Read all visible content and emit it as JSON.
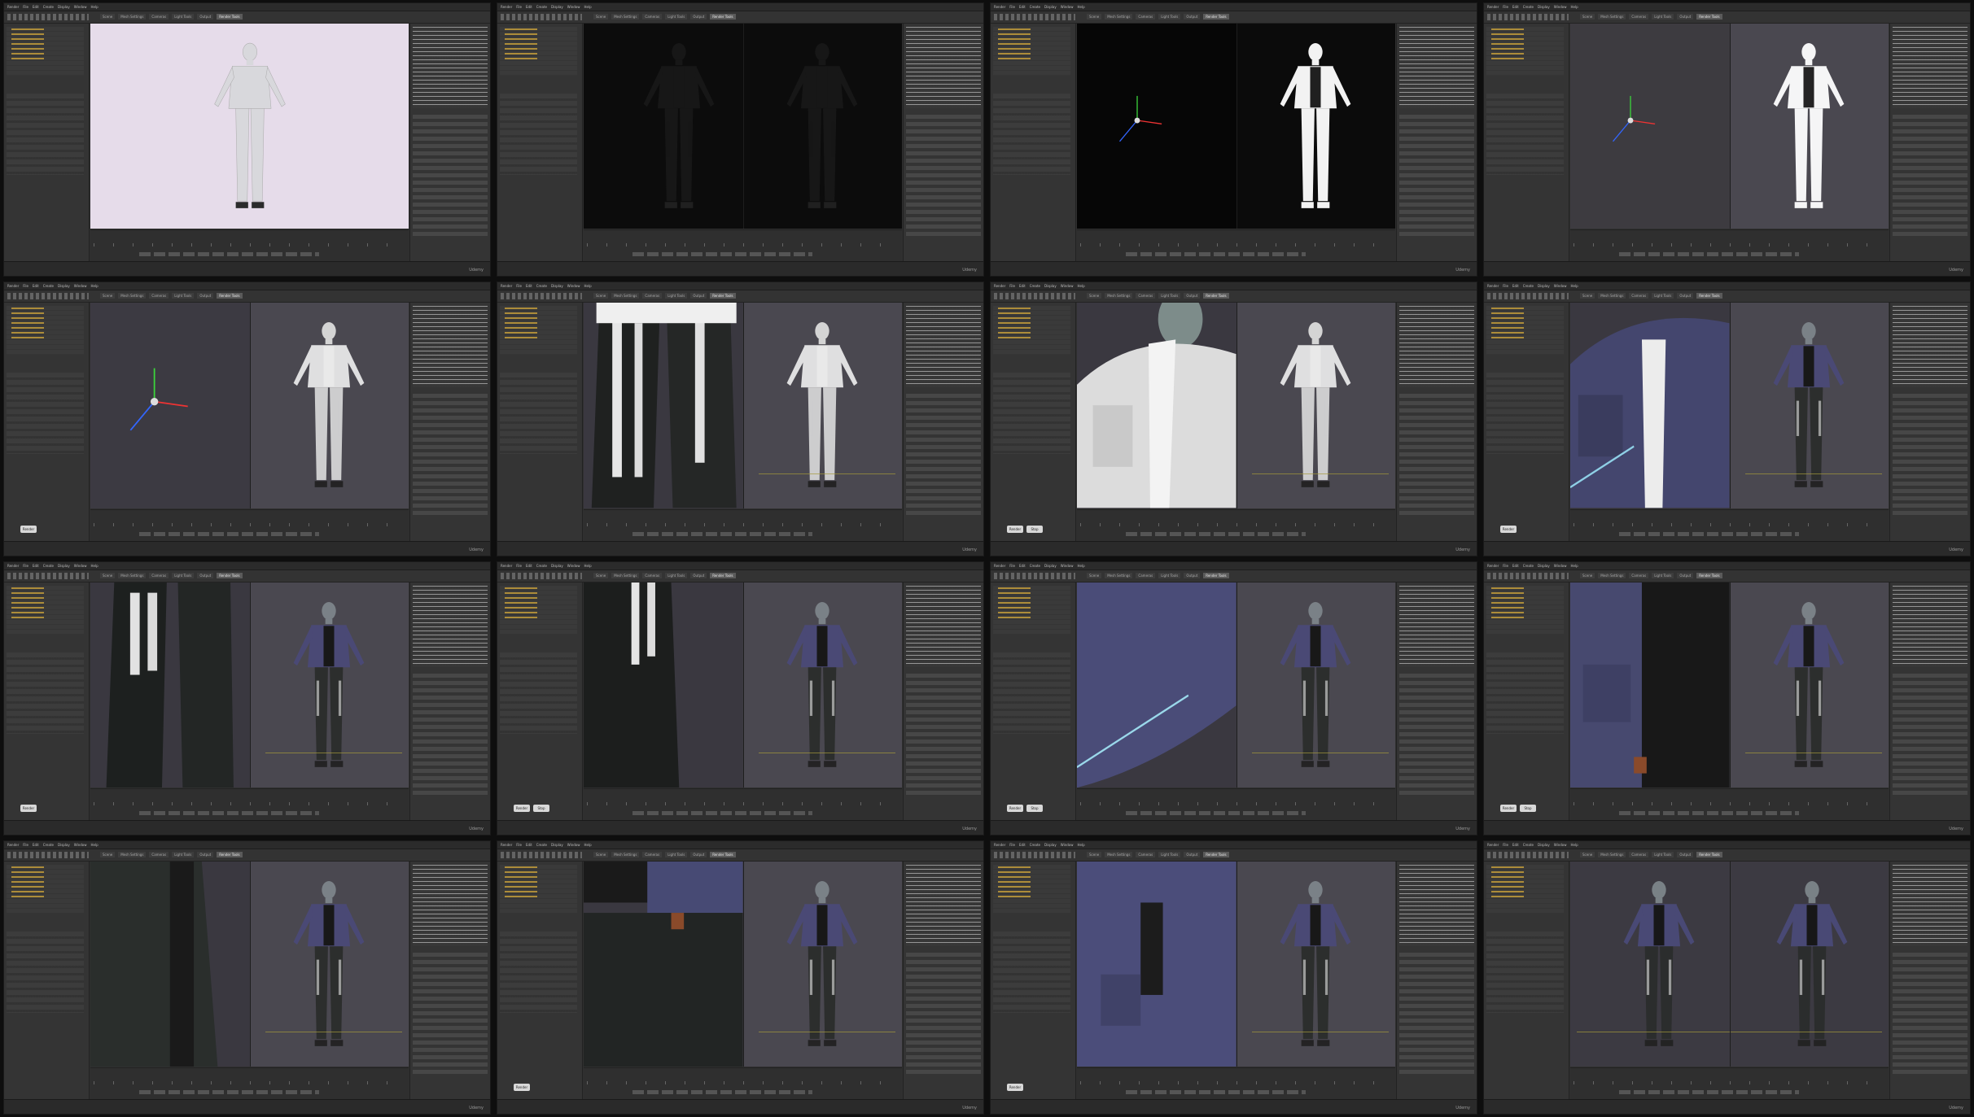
{
  "app": {
    "menu": [
      "Render",
      "File",
      "Edit",
      "Create",
      "Display",
      "Window",
      "Help"
    ],
    "toolbar_tabs": [
      "Scene",
      "Mesh Settings",
      "Cameras",
      "Light Tools",
      "Output",
      "Render Tools"
    ],
    "brand": "Udemy"
  },
  "frames": [
    {
      "scene": "clay-white",
      "split": false
    },
    {
      "scene": "dark",
      "split": true
    },
    {
      "scene": "gizmo-silhouette",
      "split": true
    },
    {
      "scene": "gizmo-silhouette-grey",
      "split": true
    },
    {
      "scene": "lights-white-figure",
      "split": true,
      "pills": [
        "Render"
      ]
    },
    {
      "scene": "pants-closeup",
      "split": true
    },
    {
      "scene": "jacket-white-closeup",
      "split": true,
      "pills": [
        "Render",
        "Stop"
      ]
    },
    {
      "scene": "jacket-blue-closeup",
      "split": true,
      "pills": [
        "Render"
      ]
    },
    {
      "scene": "legs-closeup",
      "split": true,
      "pills": [
        "Render"
      ]
    },
    {
      "scene": "boot-closeup",
      "split": true,
      "pills": [
        "Render",
        "Stop"
      ]
    },
    {
      "scene": "sleeve-closeup",
      "split": true,
      "pills": [
        "Render",
        "Stop"
      ]
    },
    {
      "scene": "pocket-closeup",
      "split": true,
      "pills": [
        "Render",
        "Stop"
      ]
    },
    {
      "scene": "thigh-closeup",
      "split": true
    },
    {
      "scene": "belt-closeup",
      "split": true,
      "pills": [
        "Render"
      ]
    },
    {
      "scene": "chest-pocket-closeup",
      "split": true,
      "pills": [
        "Render"
      ]
    },
    {
      "scene": "two-figures",
      "split": true
    }
  ],
  "colors": {
    "jacket": "#4a4a78",
    "jacket_light": "#6767a0",
    "pants": "#2b2d2c",
    "skin": "#7d858a",
    "clay": "#d8d8dc",
    "viewport_bg": "#3c3a42"
  }
}
